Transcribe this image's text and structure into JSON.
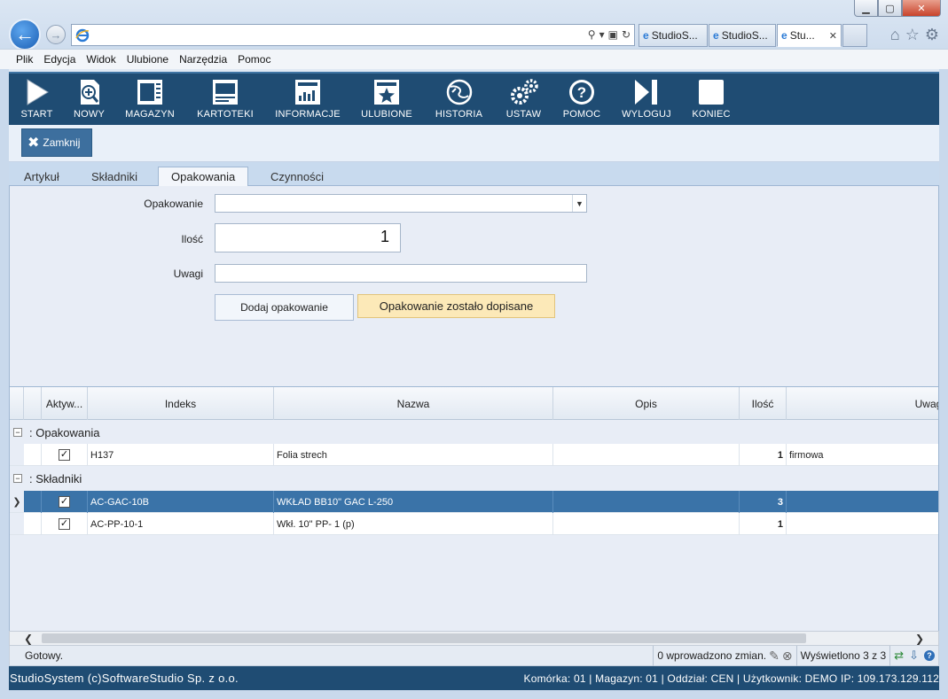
{
  "browser": {
    "tabs": [
      {
        "label": "StudioS..."
      },
      {
        "label": "StudioS..."
      },
      {
        "label": "Stu..."
      }
    ]
  },
  "menubar": {
    "items": [
      "Plik",
      "Edycja",
      "Widok",
      "Ulubione",
      "Narzędzia",
      "Pomoc"
    ]
  },
  "toolbar": {
    "items": [
      {
        "label": "START",
        "icon": "play-icon"
      },
      {
        "label": "NOWY",
        "icon": "new-document-icon"
      },
      {
        "label": "MAGAZYN",
        "icon": "warehouse-icon"
      },
      {
        "label": "KARTOTEKI",
        "icon": "records-icon"
      },
      {
        "label": "INFORMACJE",
        "icon": "chart-icon"
      },
      {
        "label": "ULUBIONE",
        "icon": "star-icon"
      },
      {
        "label": "HISTORIA",
        "icon": "history-icon"
      },
      {
        "label": "USTAW",
        "icon": "gears-icon"
      },
      {
        "label": "POMOC",
        "icon": "help-icon"
      },
      {
        "label": "WYLOGUJ",
        "icon": "logout-icon"
      },
      {
        "label": "KONIEC",
        "icon": "stop-icon"
      }
    ]
  },
  "subbar": {
    "close_label": "Zamknij"
  },
  "tabs": [
    {
      "label": "Artykuł"
    },
    {
      "label": "Składniki"
    },
    {
      "label": "Opakowania"
    },
    {
      "label": "Czynności"
    }
  ],
  "form": {
    "packaging_label": "Opakowanie",
    "packaging_value": "",
    "quantity_label": "Ilość",
    "quantity_value": "1",
    "notes_label": "Uwagi",
    "notes_value": "",
    "add_button": "Dodaj opakowanie",
    "message": "Opakowanie zostało dopisane"
  },
  "grid": {
    "columns": [
      "Aktyw...",
      "Indeks",
      "Nazwa",
      "Opis",
      "Ilość",
      "Uwagi"
    ],
    "groups": [
      {
        "title": ": Opakowania",
        "rows": [
          {
            "active": "✓",
            "index": "H137",
            "name": "Folia strech",
            "desc": "",
            "qty": "1",
            "notes": "firmowa"
          }
        ]
      },
      {
        "title": ": Składniki",
        "rows": [
          {
            "active": "✓",
            "index": "AC-GAC-10B",
            "name": "WKŁAD BB10\" GAC L-250",
            "desc": "",
            "qty": "3",
            "notes": ""
          },
          {
            "active": "✓",
            "index": "AC-PP-10-1",
            "name": "Wkł. 10\" PP- 1 (p)",
            "desc": "",
            "qty": "1",
            "notes": ""
          }
        ]
      }
    ]
  },
  "status": {
    "ready": "Gotowy.",
    "changes": "0 wprowadzono zmian.",
    "shown": "Wyświetlono 3 z 3"
  },
  "footer": {
    "left": "StudioSystem (c)SoftwareStudio Sp. z o.o.",
    "right": "Komórka: 01 | Magazyn: 01 | Oddział: CEN | Użytkownik: DEMO IP: 109.173.129.112"
  }
}
